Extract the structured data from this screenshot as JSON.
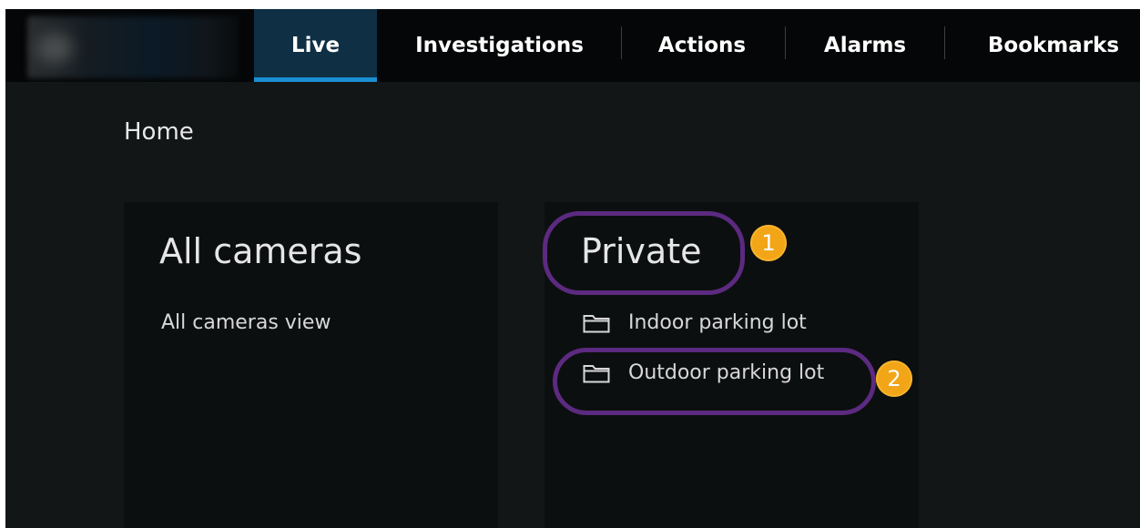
{
  "nav": {
    "tabs": [
      {
        "label": "Live",
        "active": true
      },
      {
        "label": "Investigations",
        "active": false
      },
      {
        "label": "Actions",
        "active": false
      },
      {
        "label": "Alarms",
        "active": false
      },
      {
        "label": "Bookmarks",
        "active": false
      }
    ]
  },
  "breadcrumb": "Home",
  "panels": {
    "all_cameras": {
      "title": "All cameras",
      "items": [
        "All cameras view"
      ]
    },
    "private": {
      "title": "Private",
      "items": [
        "Indoor parking lot",
        "Outdoor parking lot"
      ]
    }
  },
  "annotations": {
    "badge_1": "1",
    "badge_2": "2"
  },
  "colors": {
    "accent": "#1a8fd3",
    "active_tab_bg": "#0e2f44",
    "highlight_ring": "#5c2a80",
    "badge": "#f2a516"
  }
}
